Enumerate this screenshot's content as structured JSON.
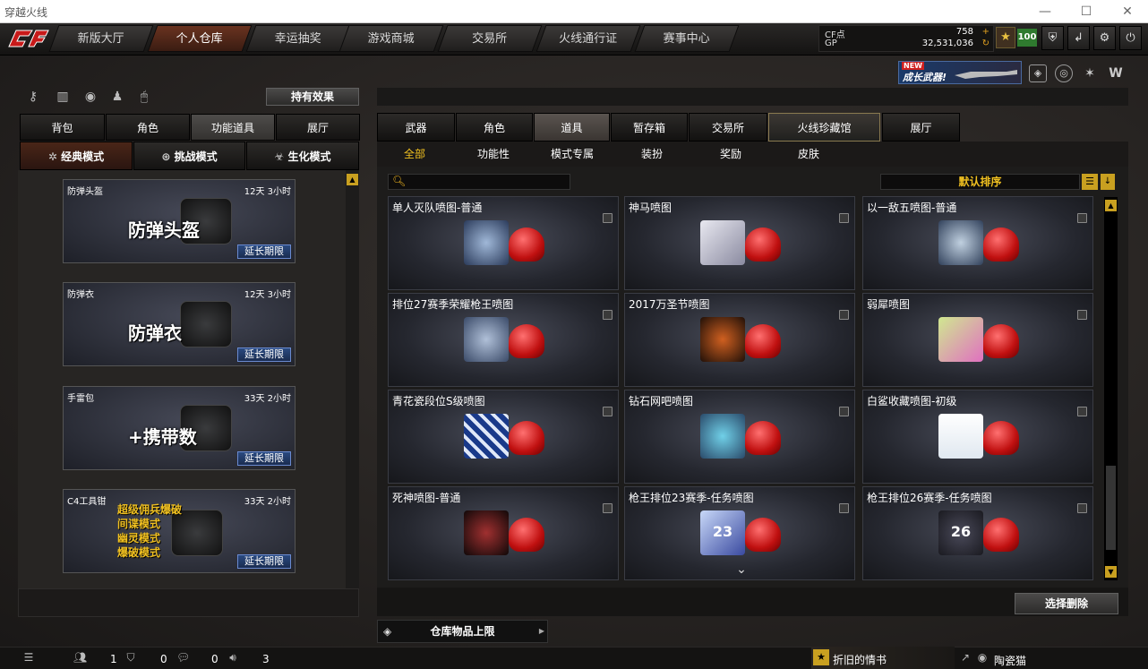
{
  "window": {
    "title": "穿越火线",
    "minimize": "—",
    "maximize": "☐",
    "close": "✕"
  },
  "nav": {
    "tabs": [
      "新版大厅",
      "个人仓库",
      "幸运抽奖",
      "游戏商城",
      "交易所",
      "火线通行证",
      "赛事中心"
    ],
    "active_index": 1
  },
  "points": {
    "cf_label": "CF点",
    "cf_value": "758",
    "gp_label": "GP",
    "gp_value": "32,531,036"
  },
  "level": "100",
  "promo": {
    "new_label": "NEW",
    "text": "成长武器!"
  },
  "effects_button": "持有效果",
  "left_tabs": [
    "背包",
    "角色",
    "功能道具",
    "展厅"
  ],
  "left_active": 2,
  "mode_tabs": [
    "经典模式",
    "挑战模式",
    "生化模式"
  ],
  "left_items": [
    {
      "name": "防弹头盔",
      "time": "12天 3小时",
      "big": "防弹头盔",
      "extend": "延长期限"
    },
    {
      "name": "防弹衣",
      "time": "12天 3小时",
      "big": "防弹衣",
      "extend": "延长期限"
    },
    {
      "name": "手雷包",
      "time": "33天 2小时",
      "big": "+携带数",
      "extend": "延长期限"
    },
    {
      "name": "C4工具钳",
      "time": "33天 2小时",
      "lines": [
        "超级佣兵爆破",
        "间谍模式",
        "幽灵模式",
        "爆破模式"
      ],
      "extend": "延长期限"
    }
  ],
  "right_tabs": [
    "武器",
    "角色",
    "道具",
    "暂存箱",
    "交易所",
    "火线珍藏馆",
    "展厅"
  ],
  "right_active": 2,
  "sub_tabs": [
    "全部",
    "功能性",
    "模式专属",
    "装扮",
    "奖励",
    "皮肤"
  ],
  "sort_label": "默认排序",
  "grid_items": [
    {
      "name": "单人灭队喷图-普通"
    },
    {
      "name": "神马喷图"
    },
    {
      "name": "以一敌五喷图-普通"
    },
    {
      "name": "排位27赛季荣耀枪王喷图"
    },
    {
      "name": "2017万圣节喷图"
    },
    {
      "name": "弱犀喷图"
    },
    {
      "name": "青花瓷段位S级喷图"
    },
    {
      "name": "钻石网吧喷图"
    },
    {
      "name": "白鲨收藏喷图-初级"
    },
    {
      "name": "死神喷图-普通"
    },
    {
      "name": "枪王排位23赛季-任务喷图",
      "badge_text": "23"
    },
    {
      "name": "枪王排位26赛季-任务喷图",
      "badge_text": "26"
    }
  ],
  "delete_button": "选择删除",
  "storage_limit": "仓库物品上限",
  "status": {
    "friends": "1",
    "clan": "0",
    "chat": "0",
    "voice": "3",
    "news": "折旧的情书",
    "user": "陶瓷猫"
  }
}
